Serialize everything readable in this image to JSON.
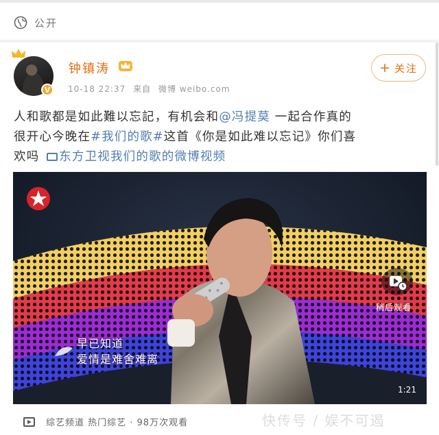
{
  "visibility": {
    "label": "公开",
    "icon": "globe-icon"
  },
  "author": {
    "name": "钟镇涛",
    "time": "10-18 22:37",
    "source_prefix": "来自",
    "source": "微博 weibo.com"
  },
  "follow": {
    "plus": "+",
    "label": "关注"
  },
  "post": {
    "l1a": "人和歌都是如此難以忘記，有机会和",
    "mention": "@冯提莫",
    "l1b": " 一起合作真的",
    "l2a": "很开心今晚在",
    "hashtag": "#我们的歌#",
    "l2b": "这首《你是如此难以忘记》你们喜",
    "l3a": "欢吗 ",
    "video_link": "东方卫视我们的歌的微博视频"
  },
  "video": {
    "lyric1": "早已知道",
    "lyric2": "爱情是难舍难离",
    "watch_later": "稍后观看",
    "duration": "1:21"
  },
  "footer": {
    "text": "综艺频道 热门综艺 · 98万次观看"
  },
  "watermark": "快传号 / 娱不可遏",
  "colors": {
    "accent": "#e46d0e",
    "link": "#507daf"
  }
}
